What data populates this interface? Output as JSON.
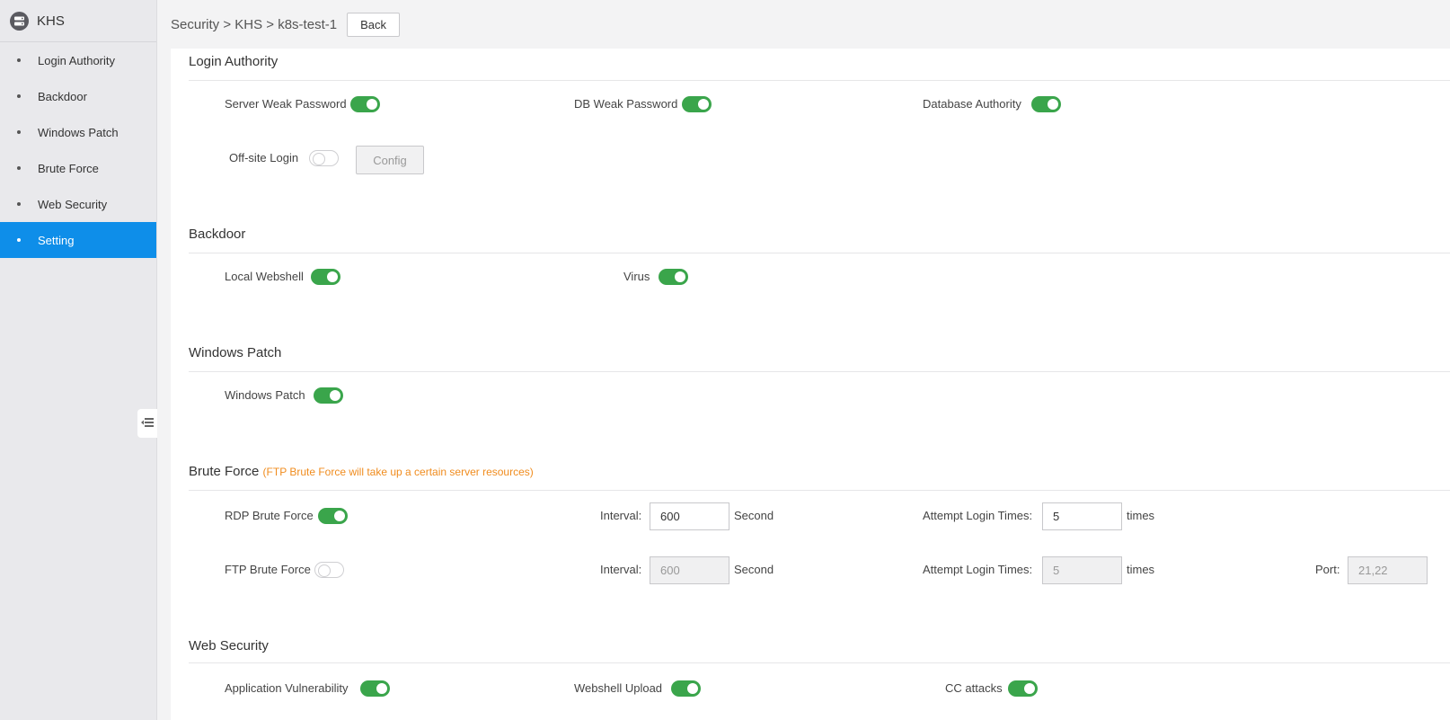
{
  "app": {
    "title": "KHS"
  },
  "sidebar": {
    "items": [
      {
        "label": "Login Authority"
      },
      {
        "label": "Backdoor"
      },
      {
        "label": "Windows Patch"
      },
      {
        "label": "Brute Force"
      },
      {
        "label": "Web Security"
      },
      {
        "label": "Setting"
      }
    ],
    "active_index": 5
  },
  "header": {
    "breadcrumb": "Security > KHS > k8s-test-1",
    "back_label": "Back"
  },
  "sections": {
    "login_authority": {
      "title": "Login Authority",
      "server_weak_password": {
        "label": "Server Weak Password",
        "on": true
      },
      "db_weak_password": {
        "label": "DB Weak Password",
        "on": true
      },
      "database_authority": {
        "label": "Database Authority",
        "on": true
      },
      "offsite_login": {
        "label": "Off-site Login",
        "on": false
      },
      "config_label": "Config"
    },
    "backdoor": {
      "title": "Backdoor",
      "local_webshell": {
        "label": "Local Webshell",
        "on": true
      },
      "virus": {
        "label": "Virus",
        "on": true
      }
    },
    "windows_patch": {
      "title": "Windows Patch",
      "windows_patch": {
        "label": "Windows Patch",
        "on": true
      }
    },
    "brute_force": {
      "title": "Brute Force",
      "note": "(FTP Brute Force will take up a certain server resources)",
      "rdp": {
        "label": "RDP Brute Force",
        "on": true,
        "interval_label": "Interval:",
        "interval_value": "600",
        "interval_unit": "Second",
        "attempts_label": "Attempt Login Times:",
        "attempts_value": "5",
        "attempts_unit": "times"
      },
      "ftp": {
        "label": "FTP Brute Force",
        "on": false,
        "interval_label": "Interval:",
        "interval_value": "600",
        "interval_unit": "Second",
        "attempts_label": "Attempt Login Times:",
        "attempts_value": "5",
        "attempts_unit": "times",
        "port_label": "Port:",
        "port_value": "21,22"
      }
    },
    "web_security": {
      "title": "Web Security",
      "application_vulnerability": {
        "label": "Application Vulnerability",
        "on": true
      },
      "webshell_upload": {
        "label": "Webshell Upload",
        "on": true
      },
      "cc_attacks": {
        "label": "CC attacks",
        "on": true
      }
    }
  },
  "colors": {
    "accent": "#0e8ee9",
    "toggle_on": "#3aa54b",
    "note": "#f08c1e"
  }
}
